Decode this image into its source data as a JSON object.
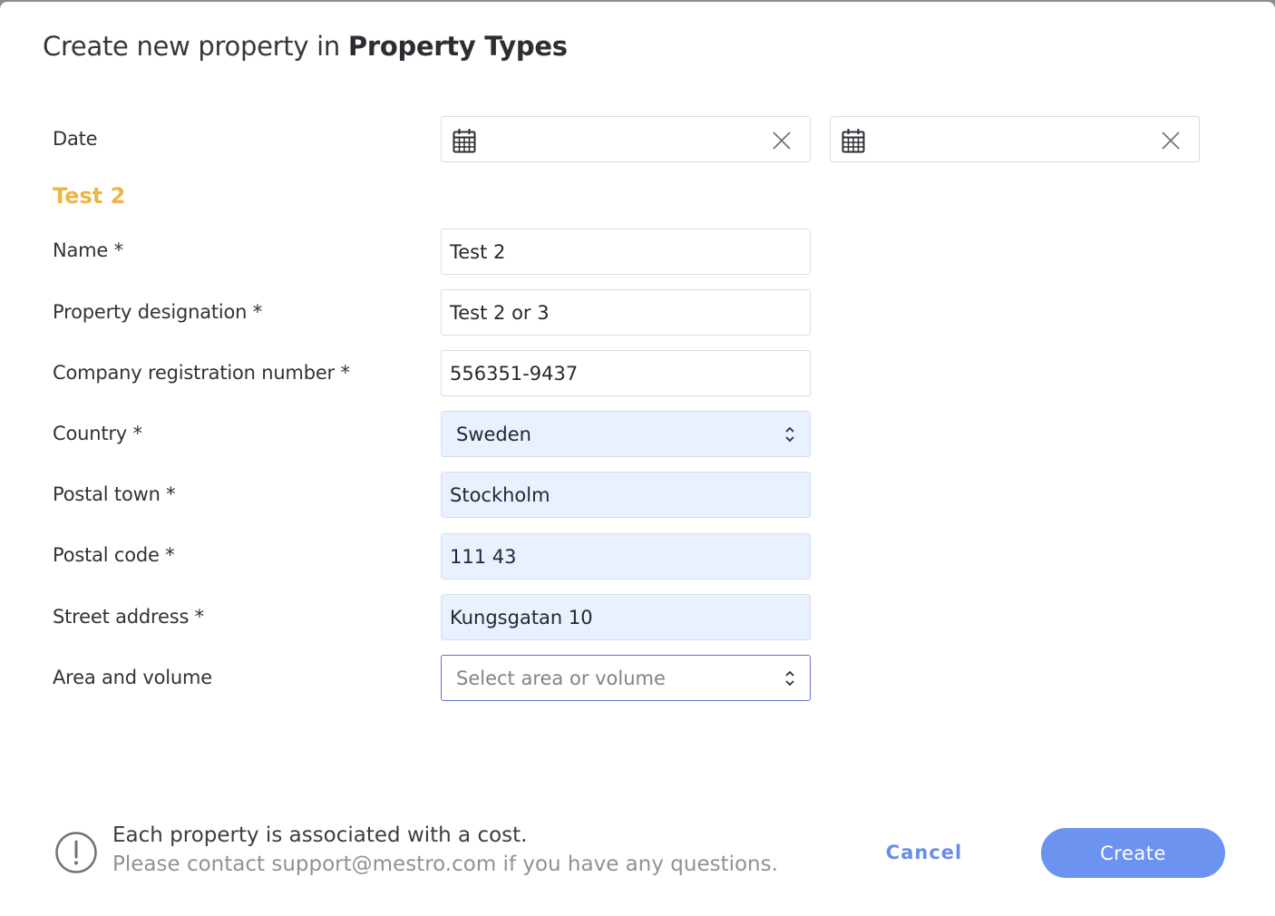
{
  "header": {
    "title_prefix": "Create new property in",
    "title_context": "Property Types"
  },
  "date": {
    "label": "Date",
    "from_value": "",
    "to_value": ""
  },
  "section": {
    "title": "Test 2"
  },
  "fields": {
    "name": {
      "label": "Name *",
      "value": "Test 2"
    },
    "property_designation": {
      "label": "Property designation *",
      "value": "Test 2 or 3"
    },
    "company_registration_number": {
      "label": "Company registration number *",
      "value": "556351-9437"
    },
    "country": {
      "label": "Country *",
      "value": "Sweden"
    },
    "postal_town": {
      "label": "Postal town *",
      "value": "Stockholm"
    },
    "postal_code": {
      "label": "Postal code *",
      "value": "111 43"
    },
    "street_address": {
      "label": "Street address *",
      "value": "Kungsgatan 10"
    },
    "area_volume": {
      "label": "Area and volume",
      "placeholder": "Select area or volume"
    }
  },
  "footer": {
    "notice_primary": "Each property is associated with a cost.",
    "notice_secondary": "Please contact support@mestro.com if you have any questions.",
    "cancel_label": "Cancel",
    "create_label": "Create"
  },
  "colors": {
    "accent": "#6b93ef",
    "section_title": "#ebb648",
    "autofill_bg": "#e9f0ff",
    "focus_border": "#6672d3"
  },
  "icons": {
    "date_icon": "calendar-icon",
    "clear_icon": "close-icon",
    "select_icon": "chevron-up-down-icon",
    "notice_icon": "exclamation-circle-icon"
  }
}
